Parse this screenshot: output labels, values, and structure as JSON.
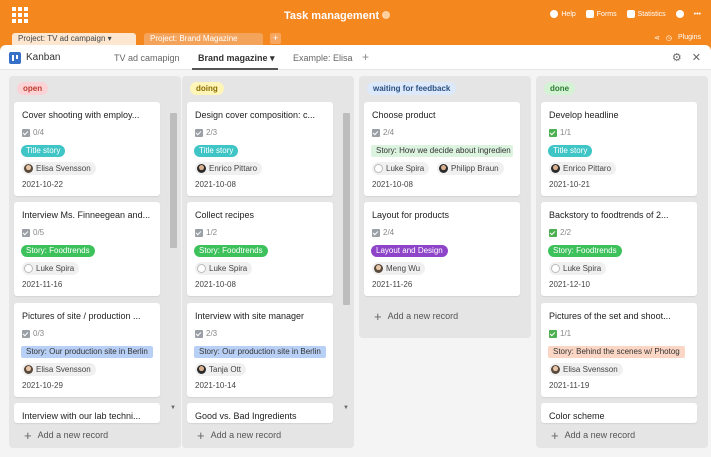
{
  "app": {
    "title": "Task management",
    "actions": [
      {
        "label": "Help",
        "icon": "help-icon"
      },
      {
        "label": "Forms",
        "icon": "forms-icon"
      },
      {
        "label": "Statistics",
        "icon": "statistics-icon"
      },
      {
        "label": "",
        "icon": "bell-icon"
      },
      {
        "label": "•••",
        "icon": "more-icon"
      }
    ]
  },
  "project_tabs": [
    {
      "label": "Project: TV ad campaign ▾",
      "active": true
    },
    {
      "label": "Project: Brand Magazine",
      "active": false
    }
  ],
  "project_tab_add": "+",
  "project_right": {
    "plugins": "Plugins"
  },
  "view": {
    "name": "Kanban",
    "tabs": [
      "TV ad camapign",
      "Brand magazine ▾",
      "Example: Elisa"
    ],
    "add": "+",
    "settings_icon": "⚙",
    "close_icon": "✕"
  },
  "add_record_label": "Add a new record",
  "columns": [
    {
      "name": "open",
      "bg": "#fbd3d6",
      "fg": "#c0392b",
      "cards": [
        {
          "title": "Cover shooting with employ...",
          "check": "0/4",
          "check_done": false,
          "tag": "Title story",
          "tag_bg": "#3fc5c5",
          "tag_fg": "#ffffff",
          "people": [
            "Elisa Svensson"
          ],
          "date": "2021-10-22"
        },
        {
          "title": "Interview Ms. Finneegean and...",
          "check": "0/5",
          "check_done": false,
          "tag": "Story: Foodtrends",
          "tag_bg": "#3cc15b",
          "tag_fg": "#ffffff",
          "people": [
            "Luke Spira"
          ],
          "date": "2021-11-16"
        },
        {
          "title": "Pictures of site / production ...",
          "check": "0/3",
          "check_done": false,
          "tag": "Story: Our production site in Berlin",
          "tag_bg": "#b8d0f5",
          "tag_fg": "#333333",
          "people": [
            "Elisa Svensson"
          ],
          "date": "2021-10-29"
        },
        {
          "title": "Interview with our lab techni...",
          "check": "",
          "check_done": false,
          "tag": "",
          "tag_bg": "",
          "tag_fg": "",
          "people": [],
          "date": ""
        }
      ]
    },
    {
      "name": "doing",
      "bg": "#fff5b8",
      "fg": "#8a6d00",
      "cards": [
        {
          "title": "Design cover composition: c...",
          "check": "2/3",
          "check_done": false,
          "tag": "Title story",
          "tag_bg": "#3fc5c5",
          "tag_fg": "#ffffff",
          "people": [
            "Enrico Pittaro"
          ],
          "date": "2021-10-08"
        },
        {
          "title": "Collect recipes",
          "check": "1/2",
          "check_done": false,
          "tag": "Story: Foodtrends",
          "tag_bg": "#3cc15b",
          "tag_fg": "#ffffff",
          "people": [
            "Luke Spira"
          ],
          "date": "2021-10-08"
        },
        {
          "title": "Interview with site manager",
          "check": "2/3",
          "check_done": false,
          "tag": "Story: Our production site in Berlin",
          "tag_bg": "#b8d0f5",
          "tag_fg": "#333333",
          "people": [
            "Tanja Ott"
          ],
          "date": "2021-10-14"
        },
        {
          "title": "Good vs. Bad Ingredients",
          "check": "",
          "check_done": false,
          "tag": "",
          "tag_bg": "",
          "tag_fg": "",
          "people": [],
          "date": ""
        }
      ]
    },
    {
      "name": "waiting for feedback",
      "bg": "#dbe9fb",
      "fg": "#2c4f80",
      "cards": [
        {
          "title": "Choose product",
          "check": "2/4",
          "check_done": false,
          "tag": "Story: How we decide about ingredien",
          "tag_bg": "#dcf3e0",
          "tag_fg": "#333333",
          "people": [
            "Luke Spira",
            "Philipp Braun"
          ],
          "date": "2021-10-08"
        },
        {
          "title": "Layout for products",
          "check": "2/4",
          "check_done": false,
          "tag": "Layout and Design",
          "tag_bg": "#8e44c9",
          "tag_fg": "#ffffff",
          "people": [
            "Meng Wu"
          ],
          "date": "2021-11-26"
        }
      ]
    },
    {
      "name": "done",
      "bg": "#d4f2d4",
      "fg": "#2e7d32",
      "cards": [
        {
          "title": "Develop headline",
          "check": "1/1",
          "check_done": true,
          "tag": "Title story",
          "tag_bg": "#3fc5c5",
          "tag_fg": "#ffffff",
          "people": [
            "Enrico Pittaro"
          ],
          "date": "2021-10-21"
        },
        {
          "title": "Backstory to foodtrends of 2...",
          "check": "2/2",
          "check_done": true,
          "tag": "Story: Foodtrends",
          "tag_bg": "#3cc15b",
          "tag_fg": "#ffffff",
          "people": [
            "Luke Spira"
          ],
          "date": "2021-12-10"
        },
        {
          "title": "Pictures of the set and shoot...",
          "check": "1/1",
          "check_done": true,
          "tag": "Story: Behind the scenes w/ Photog",
          "tag_bg": "#fbd6c4",
          "tag_fg": "#333333",
          "people": [
            "Elisa Svensson"
          ],
          "date": "2021-11-19"
        },
        {
          "title": "Color scheme",
          "check": "",
          "check_done": false,
          "tag": "",
          "tag_bg": "",
          "tag_fg": "",
          "people": [],
          "date": ""
        }
      ]
    }
  ]
}
